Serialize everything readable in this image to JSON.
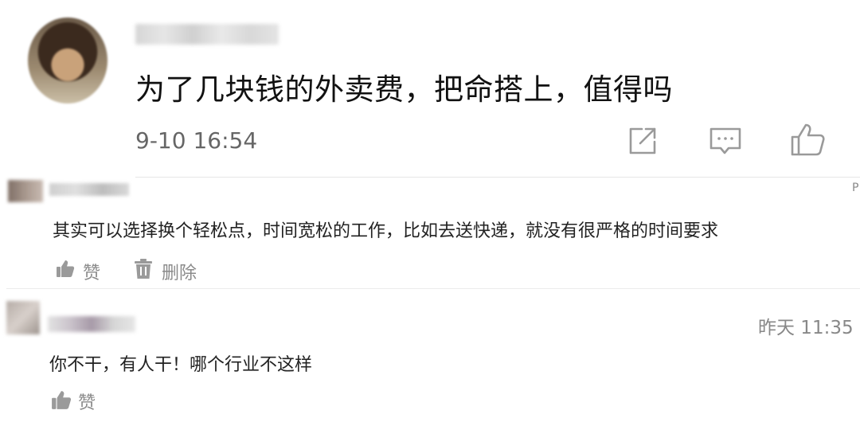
{
  "post": {
    "text": "为了几块钱的外卖费，把命搭上，值得吗",
    "time": "9-10 16:54",
    "actions": {
      "share_icon": "share-icon",
      "comment_icon": "comment-icon",
      "like_icon": "thumbs-up-icon"
    }
  },
  "comments": [
    {
      "text": "其实可以选择换个轻松点，时间宽松的工作，比如去送快递，就没有很严格的时间要求",
      "edge_char": "P",
      "like_label": "赞",
      "delete_label": "删除"
    },
    {
      "time": "昨天 11:35",
      "text": "你不干，有人干！哪个行业不这样",
      "like_label": "赞"
    }
  ],
  "colors": {
    "text_primary": "#111111",
    "text_secondary": "#8a8a8a",
    "icon_stroke": "#999999",
    "divider": "#e6e6e6"
  }
}
